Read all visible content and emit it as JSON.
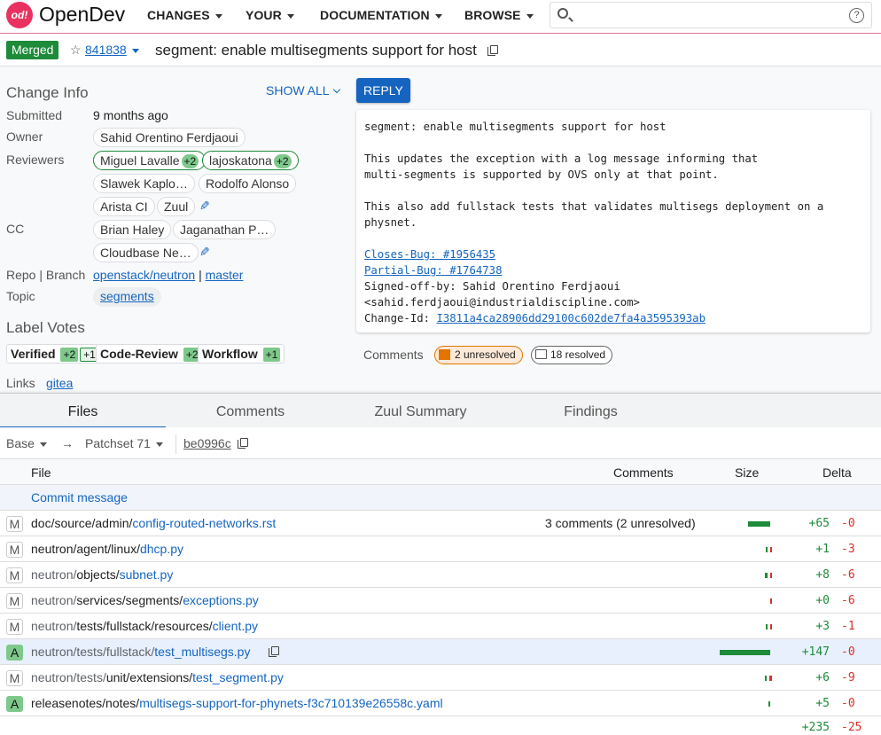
{
  "header": {
    "logo_icon": "opendev-logo",
    "logo_text": "od!",
    "brand": "OpenDev",
    "nav": [
      "CHANGES",
      "YOUR",
      "DOCUMENTATION",
      "BROWSE"
    ],
    "search_placeholder": "",
    "help_icon": "?"
  },
  "change": {
    "status": "Merged",
    "number": "841838",
    "subject": "segment: enable multisegments support for host"
  },
  "change_info": {
    "title": "Change Info",
    "show_all": "SHOW ALL",
    "submitted_label": "Submitted",
    "submitted": "9 months ago",
    "owner_label": "Owner",
    "owner": "Sahid Orentino Ferdjaoui",
    "reviewers_label": "Reviewers",
    "reviewers": [
      {
        "name": "Miguel Lavalle",
        "vote": "+2"
      },
      {
        "name": "lajoskatona",
        "vote": "+2"
      },
      {
        "name": "Slawek Kaplo…",
        "vote": ""
      },
      {
        "name": "Rodolfo Alonso",
        "vote": ""
      },
      {
        "name": "Arista CI",
        "vote": ""
      },
      {
        "name": "Zuul",
        "vote": ""
      }
    ],
    "cc_label": "CC",
    "cc": [
      "Brian Haley",
      "Jaganathan P…",
      "Cloudbase Ne…"
    ],
    "repo_branch_label": "Repo | Branch",
    "repo": "openstack/neutron",
    "separator": "|",
    "branch": "master",
    "topic_label": "Topic",
    "topic": "segments"
  },
  "label_votes": {
    "title": "Label Votes",
    "labels": [
      {
        "name": "Verified",
        "votes": [
          "+2",
          "+1"
        ]
      },
      {
        "name": "Code-Review",
        "votes": [
          "+2"
        ]
      },
      {
        "name": "Workflow",
        "votes": [
          "+1"
        ]
      }
    ]
  },
  "links": {
    "label": "Links",
    "items": [
      "gitea"
    ]
  },
  "reply_label": "REPLY",
  "commit_message": {
    "lines": [
      "segment: enable multisegments support for host",
      "",
      "This updates the exception with a log message informing that",
      "multi-segments is supported by OVS only at that point.",
      "",
      "This also add fullstack tests that validates multisegs deployment on a",
      "physnet.",
      ""
    ],
    "closes_bug": "Closes-Bug: #1956435",
    "partial_bug": "Partial-Bug: #1764738",
    "signed_off": "Signed-off-by: Sahid Orentino Ferdjaoui",
    "email": "<sahid.ferdjaoui@industrialdiscipline.com>",
    "change_id_label": "Change-Id: ",
    "change_id": "I3811a4ca28906dd29100c602de7fa4a3595393ab"
  },
  "comments_summary": {
    "label": "Comments",
    "unresolved": "2 unresolved",
    "resolved": "18 resolved"
  },
  "tabs": [
    "Files",
    "Comments",
    "Zuul Summary",
    "Findings"
  ],
  "patchset": {
    "base": "Base",
    "arrow": "→",
    "patchset": "Patchset 71",
    "commit": "be0996c"
  },
  "file_table": {
    "headers": {
      "file": "File",
      "comments": "Comments",
      "size": "Size",
      "delta": "Delta"
    },
    "commit_message_row": "Commit message",
    "files": [
      {
        "status": "M",
        "dim": "",
        "dir": "doc/source/admin/",
        "name": "config-routed-networks.rst",
        "comments": "3 comments (2 unresolved)",
        "added": 65,
        "deleted": 0
      },
      {
        "status": "M",
        "dim": "",
        "dir": "neutron/agent/linux/",
        "name": "dhcp.py",
        "comments": "",
        "added": 1,
        "deleted": 3
      },
      {
        "status": "M",
        "dim": "neutron/",
        "dir": "objects/",
        "name": "subnet.py",
        "comments": "",
        "added": 8,
        "deleted": 6
      },
      {
        "status": "M",
        "dim": "neutron/",
        "dir": "services/segments/",
        "name": "exceptions.py",
        "comments": "",
        "added": 0,
        "deleted": 6
      },
      {
        "status": "M",
        "dim": "neutron/",
        "dir": "tests/fullstack/resources/",
        "name": "client.py",
        "comments": "",
        "added": 3,
        "deleted": 1
      },
      {
        "status": "A",
        "dim": "neutron/tests/fullstack/",
        "dir": "",
        "name": "test_multisegs.py",
        "comments": "",
        "added": 147,
        "deleted": 0
      },
      {
        "status": "M",
        "dim": "neutron/tests/",
        "dir": "unit/extensions/",
        "name": "test_segment.py",
        "comments": "",
        "added": 6,
        "deleted": 9
      },
      {
        "status": "A",
        "dim": "",
        "dir": "releasenotes/notes/",
        "name": "multisegs-support-for-phynets-f3c710139e26558c.yaml",
        "comments": "",
        "added": 5,
        "deleted": 0
      }
    ],
    "total_added": "+235",
    "total_deleted": "-25"
  },
  "colors": {
    "brand": "#e9325f",
    "accent": "#1565c0",
    "merged": "#1e8b3a",
    "added": "#1e8b3a",
    "deleted": "#d93025",
    "unresolved": "#e37400"
  }
}
